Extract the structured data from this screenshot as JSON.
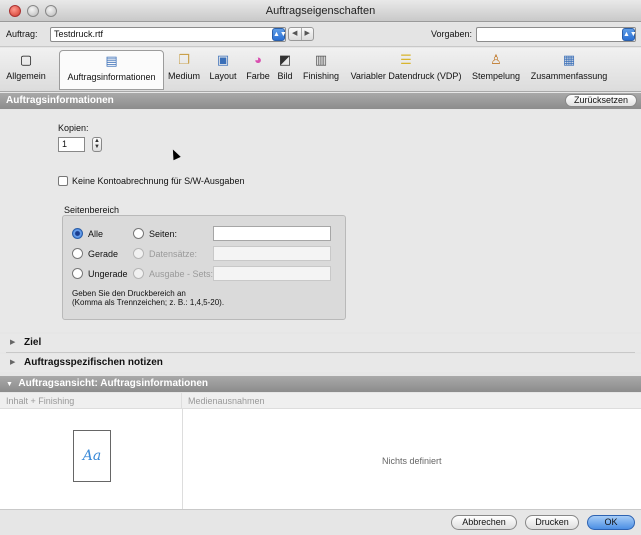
{
  "window": {
    "title": "Auftragseigenschaften"
  },
  "jobbar": {
    "job_label": "Auftrag:",
    "job_value": "Testdruck.rtf",
    "presets_label": "Vorgaben:",
    "presets_value": ""
  },
  "toolbar": {
    "tabs": [
      {
        "label": "Allgemein",
        "icon": "blank-page-icon"
      },
      {
        "label": "Auftragsinformationen",
        "icon": "document-info-icon"
      },
      {
        "label": "Medium",
        "icon": "paper-icon"
      },
      {
        "label": "Layout",
        "icon": "layout-icon"
      },
      {
        "label": "Farbe",
        "icon": "color-wheel-icon"
      },
      {
        "label": "Bild",
        "icon": "image-icon"
      },
      {
        "label": "Finishing",
        "icon": "finishing-icon"
      },
      {
        "label": "Variabler Datendruck (VDP)",
        "icon": "vdp-icon"
      },
      {
        "label": "Stempelung",
        "icon": "stamp-icon"
      },
      {
        "label": "Zusammenfassung",
        "icon": "summary-icon"
      }
    ],
    "active_tab": "Auftragsinformationen"
  },
  "section": {
    "title": "Auftragsinformationen",
    "reset_label": "Zurücksetzen"
  },
  "copies": {
    "label": "Kopien:",
    "value": "1"
  },
  "accounting": {
    "label": "Keine Kontoabrechnung für S/W-Ausgaben",
    "checked": false
  },
  "page_range": {
    "title": "Seitenbereich",
    "options": {
      "all": "Alle",
      "pages": "Seiten:",
      "even": "Gerade",
      "records": "Datensätze:",
      "odd": "Ungerade",
      "output_sets": "Ausgabe - Sets:"
    },
    "selected": "all",
    "hint_line1": "Geben Sie den Druckbereich an",
    "hint_line2": "(Komma als Trennzeichen; z. B.: 1,4,5-20)."
  },
  "collapsed_sections": {
    "destination": "Ziel",
    "job_notes": "Auftragsspezifischen notizen"
  },
  "job_view": {
    "title": "Auftragsansicht: Auftragsinformationen",
    "col_content": "Inhalt + Finishing",
    "col_media": "Medienausnahmen",
    "thumb_text": "Aa",
    "empty_text": "Nichts definiert"
  },
  "buttons": {
    "cancel": "Abbrechen",
    "print": "Drucken",
    "ok": "OK"
  }
}
